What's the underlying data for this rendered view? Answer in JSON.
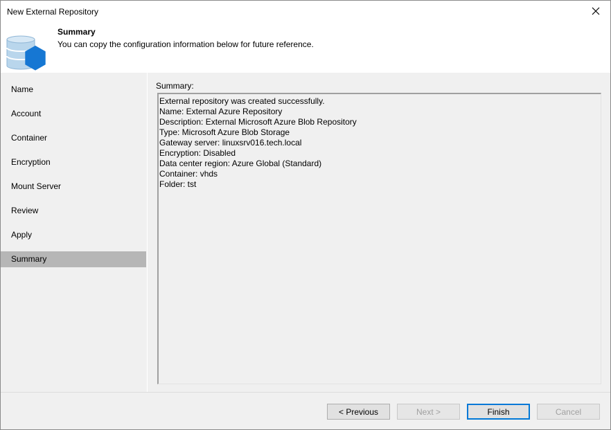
{
  "window": {
    "title": "New External Repository"
  },
  "header": {
    "title": "Summary",
    "description": "You can copy the configuration information below for future reference."
  },
  "nav": {
    "items": [
      {
        "label": "Name"
      },
      {
        "label": "Account"
      },
      {
        "label": "Container"
      },
      {
        "label": "Encryption"
      },
      {
        "label": "Mount Server"
      },
      {
        "label": "Review"
      },
      {
        "label": "Apply"
      },
      {
        "label": "Summary",
        "active": true
      }
    ]
  },
  "summary": {
    "label": "Summary:",
    "lines": [
      "External repository was created successfully.",
      "Name: External Azure Repository",
      "Description: External Microsoft Azure Blob Repository",
      "Type: Microsoft Azure Blob Storage",
      "Gateway server: linuxsrv016.tech.local",
      "Encryption: Disabled",
      "Data center region: Azure Global (Standard)",
      "Container: vhds",
      "Folder: tst"
    ]
  },
  "footer": {
    "previous_label": "< Previous",
    "next_label": "Next >",
    "finish_label": "Finish",
    "cancel_label": "Cancel"
  },
  "icons": {
    "logo": "database-hexagon-icon",
    "close": "close-icon"
  },
  "colors": {
    "accent": "#0078d7",
    "nav_active": "#b6b6b6",
    "panel_bg": "#f0f0f0"
  }
}
